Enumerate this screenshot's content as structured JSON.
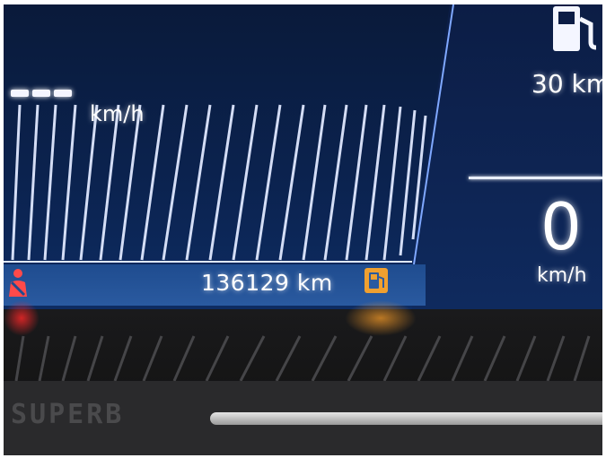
{
  "cluster": {
    "odometer": "136129 km",
    "speed_unit_top": "km/h",
    "range": "30 km",
    "speed_value": "0",
    "speed_unit": "km/h"
  },
  "trim": {
    "brand": "SUPERB"
  },
  "colors": {
    "display_blue": "#0b2350",
    "warning_orange": "#f0a030",
    "warning_red": "#e02020"
  },
  "icons": [
    "fuel-pump-icon",
    "fuel-warning-icon",
    "seatbelt-warning-icon"
  ]
}
